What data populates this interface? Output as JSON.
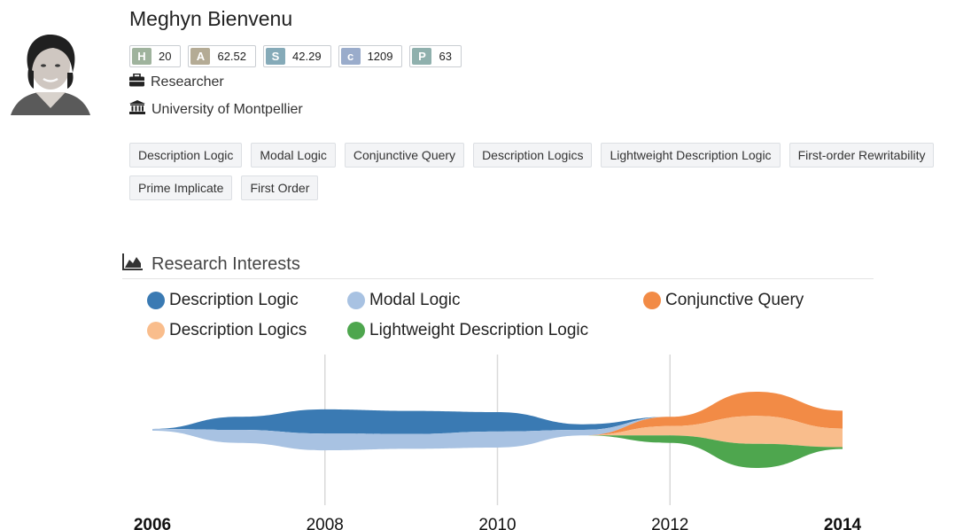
{
  "profile": {
    "name": "Meghyn Bienvenu",
    "position": "Researcher",
    "affiliation": "University of Montpellier",
    "metrics": [
      {
        "key": "H",
        "value": "20",
        "color": "#9fb39d"
      },
      {
        "key": "A",
        "value": "62.52",
        "color": "#b4ab95"
      },
      {
        "key": "S",
        "value": "42.29",
        "color": "#85aab8"
      },
      {
        "key": "c",
        "value": "1209",
        "color": "#9aaccb"
      },
      {
        "key": "P",
        "value": "63",
        "color": "#8fb0ad"
      }
    ]
  },
  "tags": [
    "Description Logic",
    "Modal Logic",
    "Conjunctive Query",
    "Description Logics",
    "Lightweight Description Logic",
    "First-order Rewritability",
    "Prime Implicate",
    "First Order"
  ],
  "section": {
    "title": "Research Interests",
    "icon": "area-chart-icon"
  },
  "chart_data": {
    "type": "area",
    "style": "streamgraph",
    "x": [
      2006,
      2007,
      2008,
      2009,
      2010,
      2011,
      2012,
      2013,
      2014
    ],
    "xticks": [
      "2006",
      "2008",
      "2010",
      "2012",
      "2014"
    ],
    "xticks_bold": [
      "2006",
      "2014"
    ],
    "xlim": [
      2006,
      2014
    ],
    "grid": "vertical",
    "legend": "top",
    "series": [
      {
        "name": "Description Logic",
        "color": "#3a7ab3",
        "values": [
          0,
          3.5,
          6.5,
          6.2,
          5.2,
          1.5,
          0,
          0,
          0
        ]
      },
      {
        "name": "Modal Logic",
        "color": "#a8c2e2",
        "values": [
          0.5,
          3.5,
          4.5,
          4.0,
          4.3,
          1.5,
          0,
          0,
          0
        ]
      },
      {
        "name": "Conjunctive Query",
        "color": "#f28b46",
        "values": [
          0,
          0,
          0,
          0,
          0,
          0,
          2.5,
          6.5,
          4.8
        ]
      },
      {
        "name": "Description Logics",
        "color": "#f9bd8c",
        "values": [
          0,
          0,
          0,
          0,
          0,
          0,
          2.5,
          7.5,
          5.0
        ]
      },
      {
        "name": "Lightweight Description Logic",
        "color": "#4ea64e",
        "values": [
          0,
          0,
          0,
          0,
          0,
          0,
          2.0,
          6.5,
          0.5
        ]
      }
    ]
  }
}
